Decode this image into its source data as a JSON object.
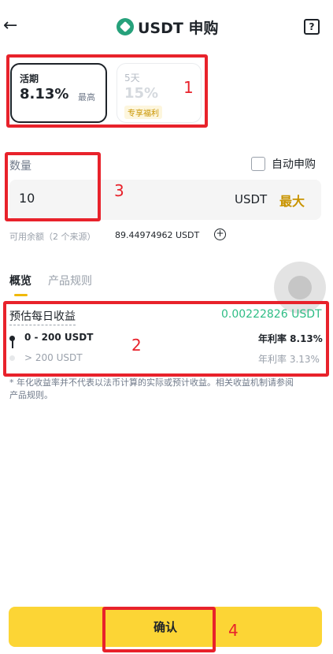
{
  "header": {
    "title": "USDT 申购",
    "back_icon": "arrow-left-icon",
    "help_icon": "help-icon",
    "token_icon": "usdt-token-icon"
  },
  "terms": [
    {
      "name": "活期",
      "rate": "8.13%",
      "subtitle": "最高",
      "selected": true
    },
    {
      "name": "5天",
      "rate": "15%",
      "badge": "专享福利",
      "selected": false
    }
  ],
  "amount": {
    "label": "数量",
    "value": "10",
    "unit": "USDT",
    "max_label": "最大",
    "auto_subscribe_label": "自动申购",
    "available_label": "可用余额（2 个来源）",
    "available_value": "89.44974962 USDT"
  },
  "tabs": [
    "概览",
    "产品规则"
  ],
  "overview": {
    "est_label": "预估每日收益",
    "est_value": "0.00222826 USDT",
    "tiers": [
      {
        "range": "0 - 200 USDT",
        "rate": "年利率 8.13%",
        "active": true
      },
      {
        "range": "> 200 USDT",
        "rate": "年利率 3.13%",
        "active": false
      }
    ],
    "disclaimer": "* 年化收益率并不代表以法币计算的实际或预计收益。相关收益机制请参阅产品规则。"
  },
  "confirm_label": "确认",
  "annotations": [
    "1",
    "2",
    "3",
    "4"
  ],
  "colors": {
    "accent": "#fcd535",
    "accent_text": "#c99400",
    "positive": "#2ebd85",
    "annotation": "#e8222b"
  }
}
